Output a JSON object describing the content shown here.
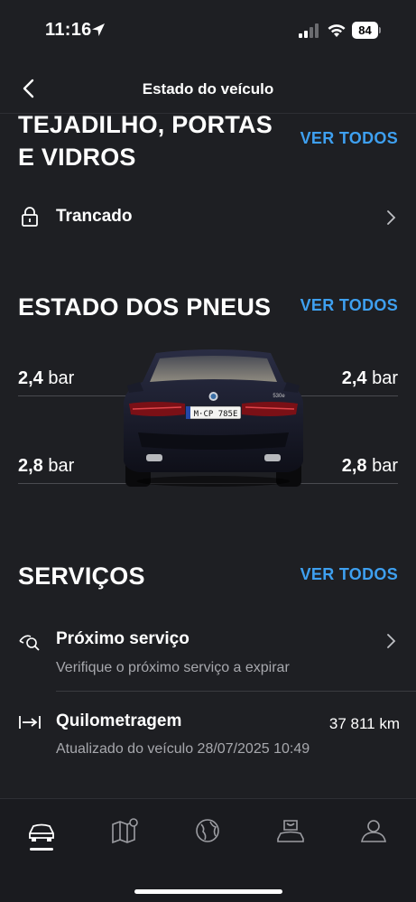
{
  "status_bar": {
    "time": "11:16",
    "battery": "84"
  },
  "header": {
    "title": "Estado do veículo"
  },
  "roof_section": {
    "title_line1": "TEJADILHO, PORTAS",
    "title_line2": "E VIDROS",
    "see_all": "VER TODOS",
    "lock_status": "Trancado"
  },
  "tyres_section": {
    "title": "ESTADO DOS PNEUS",
    "see_all": "VER TODOS",
    "front_left": {
      "value": "2,4",
      "unit": "bar"
    },
    "front_right": {
      "value": "2,4",
      "unit": "bar"
    },
    "rear_left": {
      "value": "2,8",
      "unit": "bar"
    },
    "rear_right": {
      "value": "2,8",
      "unit": "bar"
    },
    "car": {
      "plate": "M·CP 785E",
      "badge": "530e",
      "color": "#1a1c2e"
    }
  },
  "services_section": {
    "title": "SERVIÇOS",
    "see_all": "VER TODOS",
    "next_service": {
      "title": "Próximo serviço",
      "subtitle": "Verifique o próximo serviço a expirar"
    },
    "mileage": {
      "title": "Quilometragem",
      "value": "37 811 km",
      "subtitle": "Atualizado do veículo 28/07/2025 10:49"
    }
  },
  "tab_bar": {
    "items": [
      "car-icon",
      "map-icon",
      "globe-icon",
      "shop-icon",
      "profile-icon"
    ],
    "active": 0
  },
  "colors": {
    "accent": "#3ea0f0",
    "background": "#1e1f23"
  }
}
